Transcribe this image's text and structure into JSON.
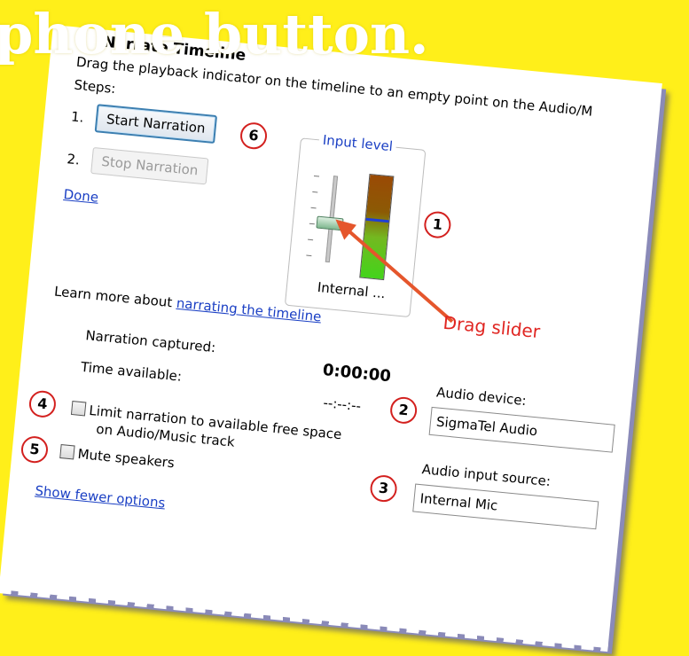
{
  "banner_text": "phone button.",
  "dialog": {
    "title": "Narrate Timeline",
    "instruction": "Drag the playback indicator on the timeline to an empty point on the Audio/M",
    "steps_label": "Steps:",
    "step1_number": "1.",
    "step2_number": "2.",
    "start_button": "Start Narration",
    "stop_button": "Stop Narration",
    "done_link": "Done",
    "input_level": {
      "legend": "Input level",
      "device_short": "Internal ...",
      "slider_value_fraction": 0.55,
      "meter_level_fraction": 0.58
    },
    "learn_more_prefix": "Learn more about ",
    "learn_more_link": "narrating the timeline",
    "narration_captured_label": "Narration captured:",
    "narration_captured_value": "0:00:00",
    "time_available_label": "Time available:",
    "time_available_value": "--:--:--",
    "audio_device_label": "Audio device:",
    "audio_device_value": "SigmaTel Audio",
    "audio_input_label": "Audio input source:",
    "audio_input_value": "Internal Mic",
    "limit_checkbox_line1": "Limit narration to available free space",
    "limit_checkbox_line2": "on Audio/Music track",
    "mute_checkbox": "Mute speakers",
    "show_fewer_link": "Show fewer options"
  },
  "annotations": {
    "drag_slider": "Drag slider",
    "callouts": [
      "1",
      "2",
      "3",
      "4",
      "5",
      "6"
    ],
    "callout_color": "#d3201e",
    "arrow_color": "#e5562c"
  }
}
